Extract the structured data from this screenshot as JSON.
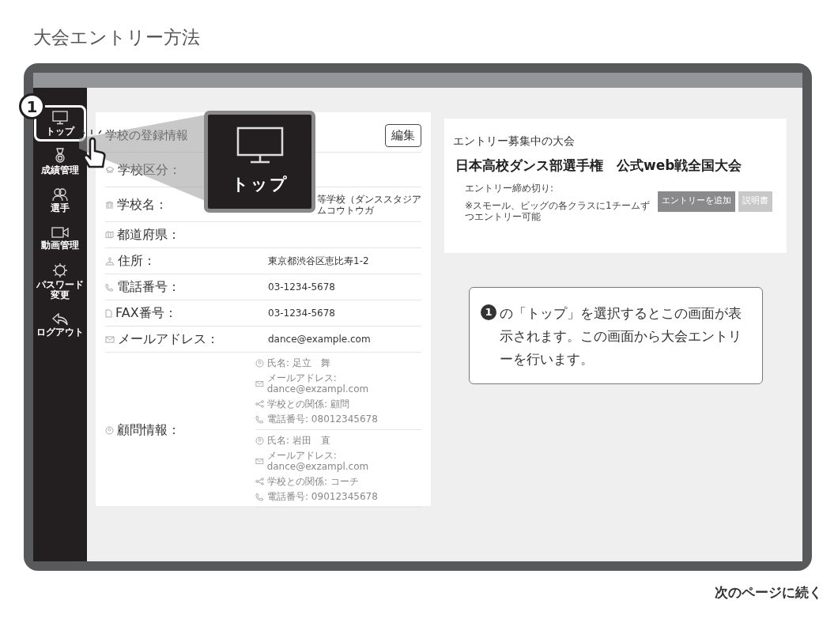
{
  "page_title": "大会エントリー方法",
  "sidebar": {
    "items": [
      {
        "label": "トップ",
        "selected": true
      },
      {
        "label": "成績管理",
        "selected": false
      },
      {
        "label": "選手",
        "selected": false
      },
      {
        "label": "動画管理",
        "selected": false
      },
      {
        "label": "パスワード変更",
        "selected": false
      },
      {
        "label": "ログアウト",
        "selected": false
      }
    ]
  },
  "step_badge": "1",
  "zoom_popup": {
    "label": "トップ"
  },
  "school_card": {
    "title": "学校の登録情報",
    "edit_button": "編集",
    "fields": [
      {
        "label": "学校区分："
      },
      {
        "label": "学校名：",
        "value": "等学校（ダンススタジアムコウトウガ",
        "kind": "covered"
      },
      {
        "label": "都道府県："
      },
      {
        "label": "住所：",
        "value": "東京都渋谷区恵比寿1-2"
      },
      {
        "label": "電話番号：",
        "value": "03-1234-5678"
      },
      {
        "label": "FAX番号：",
        "value": "03-1234-5678"
      },
      {
        "label": "メールアドレス：",
        "value": "dance@example.com"
      }
    ],
    "advisor": {
      "label": "顧問情報：",
      "people": [
        {
          "lines": [
            "氏名: 足立　舞",
            "メールアドレス: dance@exzampl.com",
            "学校との関係: 顧問",
            "電話番号: 08012345678"
          ]
        },
        {
          "lines": [
            "氏名: 岩田　直",
            "メールアドレス: dance@exzampl.com",
            "学校との関係: コーチ",
            "電話番号: 09012345678"
          ]
        }
      ]
    }
  },
  "entry_card": {
    "heading": "エントリー募集中の大会",
    "event_title": "日本高校ダンス部選手権　公式web戦全国大会",
    "deadline": "エントリー締め切り:",
    "note": "※スモール、ビッグの各クラスに1チームずつエントリー可能",
    "buttons": [
      {
        "label": "エントリーを追加",
        "disabled": false
      },
      {
        "label": "説明書",
        "disabled": true
      }
    ]
  },
  "callout": {
    "step": "1",
    "text": "の「トップ」を選択するとこの画面が表示されます。この画面から大会エントリーを行います。"
  },
  "footer": "次のページに続く"
}
